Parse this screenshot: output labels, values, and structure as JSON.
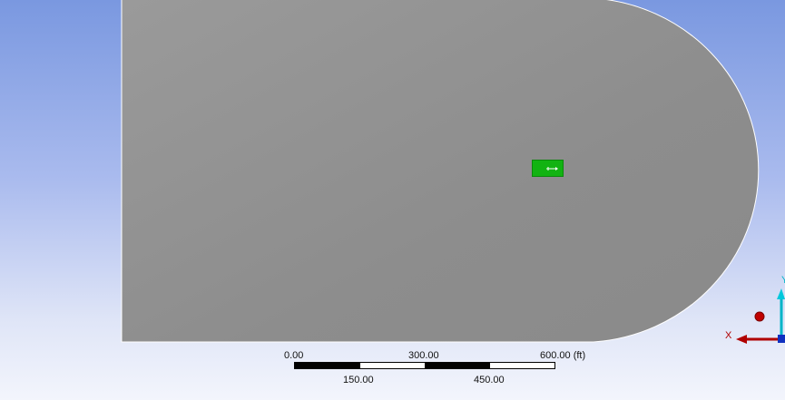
{
  "viewport": {
    "background_top_color": "#7a98e0",
    "background_bottom_color": "#f3f5fc",
    "model_color": "#8f8f8f"
  },
  "probe_marker": {
    "color": "#12b312",
    "icon": "flow-arrow-icon"
  },
  "scale_bar": {
    "labels_top": [
      "0.00",
      "300.00",
      "600.00 (ft)"
    ],
    "labels_bottom": [
      "150.00",
      "450.00"
    ],
    "segments": [
      "dark",
      "light",
      "dark",
      "light"
    ]
  },
  "triad": {
    "x_label": "X",
    "y_label": "Y",
    "x_color": "#b00000",
    "y_color": "#00b5c8"
  }
}
